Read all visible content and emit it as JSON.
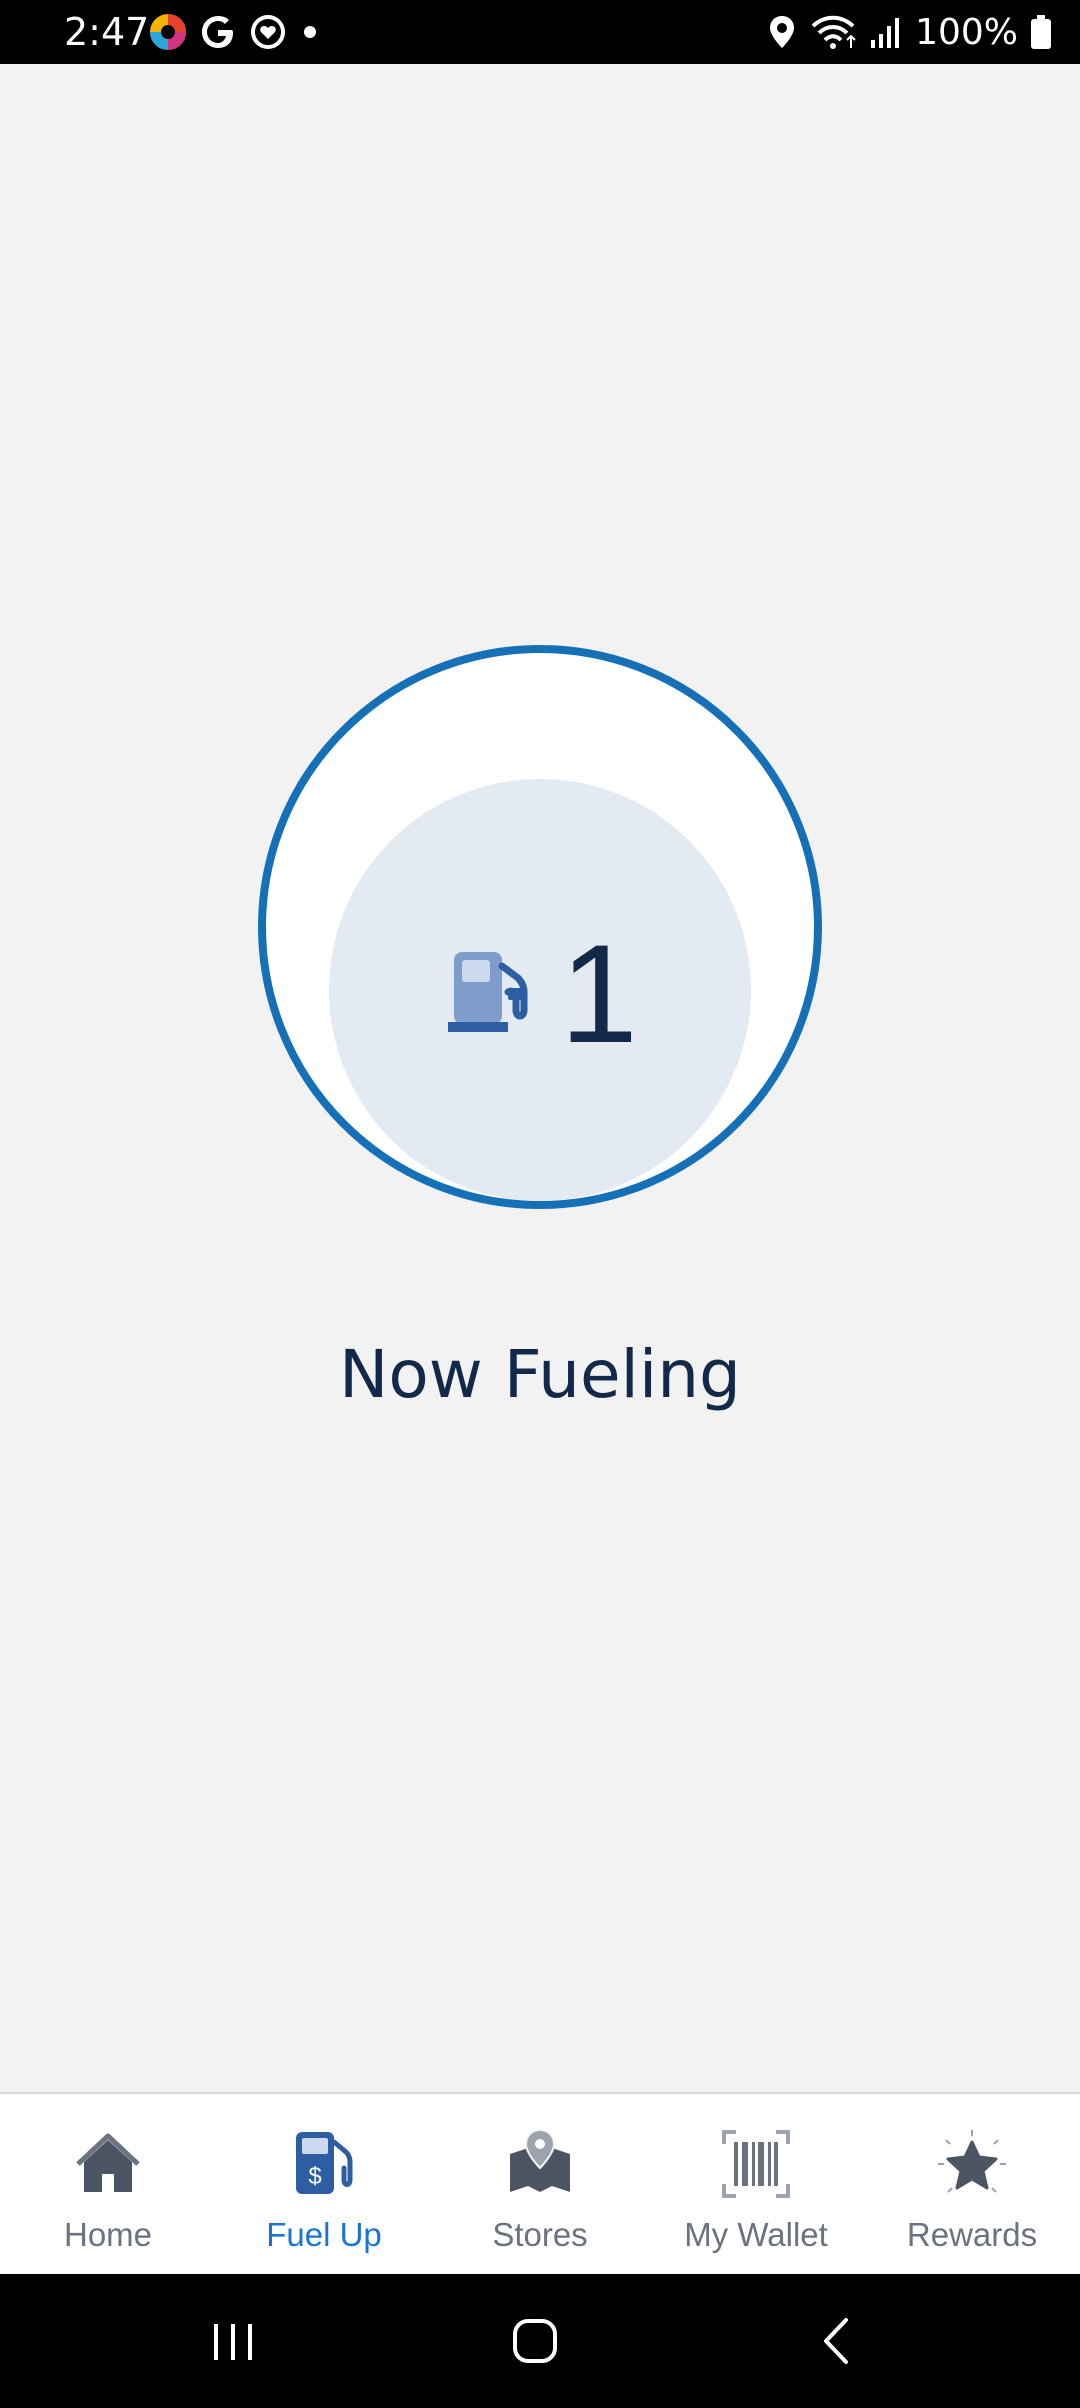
{
  "status_bar": {
    "time": "2:47",
    "battery": "100%",
    "left_icons": [
      "colorful-app-icon",
      "google-icon",
      "heart-chat-icon",
      "notification-dot-icon"
    ],
    "right_icons": [
      "location-icon",
      "wifi-icon",
      "signal-icon",
      "battery-icon"
    ]
  },
  "pump": {
    "number": "1",
    "status": "Now Fueling",
    "icon": "fuel-pump-icon"
  },
  "colors": {
    "ring": "#1570b7",
    "inner_circle": "#e3eaf2",
    "text_dark": "#12294a",
    "active_tab": "#1a73d6",
    "inactive_tab": "#6b7280"
  },
  "tabs": [
    {
      "label": "Home",
      "icon": "home-icon",
      "active": false
    },
    {
      "label": "Fuel Up",
      "icon": "fuel-pump-dollar-icon",
      "active": true
    },
    {
      "label": "Stores",
      "icon": "map-pin-icon",
      "active": false
    },
    {
      "label": "My Wallet",
      "icon": "barcode-icon",
      "active": false
    },
    {
      "label": "Rewards",
      "icon": "star-icon",
      "active": false
    }
  ],
  "nav_bar": {
    "buttons": [
      "recent-apps",
      "home",
      "back"
    ]
  }
}
